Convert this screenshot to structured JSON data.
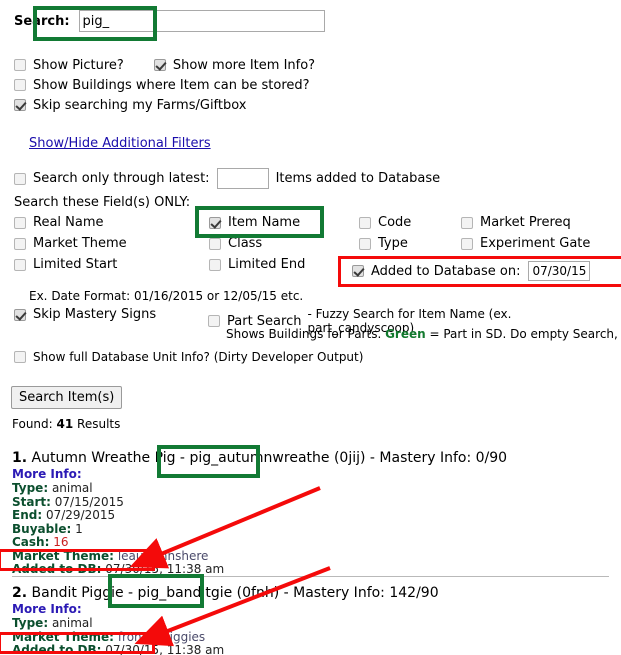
{
  "search": {
    "label": "Search:",
    "value": "pig_",
    "placeholder": ""
  },
  "options": [
    {
      "label": "Show Picture?",
      "checked": false
    },
    {
      "label": "Show more Item Info?",
      "checked": true
    },
    {
      "label": "Show Buildings where Item can be stored?",
      "checked": false
    },
    {
      "label": "Skip searching my Farms/Giftbox",
      "checked": true
    }
  ],
  "filters_link": "Show/Hide Additional Filters",
  "latest": {
    "checkbox_label": "Search only through latest:",
    "checked": false,
    "value": "",
    "suffix": "Items added to Database"
  },
  "fields_heading": "Search these Field(s) ONLY:",
  "fields": [
    {
      "label": "Real Name",
      "checked": false
    },
    {
      "label": "Item Name",
      "checked": true
    },
    {
      "label": "Code",
      "checked": false
    },
    {
      "label": "Market Prereq",
      "checked": false
    },
    {
      "label": "Market Theme",
      "checked": false
    },
    {
      "label": "Class",
      "checked": false
    },
    {
      "label": "Type",
      "checked": false
    },
    {
      "label": "Experiment Gate",
      "checked": false
    },
    {
      "label": "Limited Start",
      "checked": false
    },
    {
      "label": "Limited End",
      "checked": false
    }
  ],
  "added_to_db": {
    "label": "Added to Database on:",
    "checked": true,
    "value": "07/30/15"
  },
  "date_format_hint": "Ex. Date Format: 01/16/2015 or 12/05/15 etc.",
  "mastery": {
    "label": "Skip Mastery Signs",
    "checked": true
  },
  "part_search": {
    "label": "Part Search",
    "checked": false,
    "note": "- Fuzzy Search for Item Name (ex. part_candyscoop)",
    "note2_prefix": "Shows Buildings for Parts. ",
    "note2_green": "Green",
    "note2_suffix": " = Part in SD. Do empty Search, skip fa"
  },
  "full_db_info": {
    "label": "Show full Database Unit Info? (Dirty Developer Output)",
    "checked": false
  },
  "search_button": "Search Item(s)",
  "found": {
    "prefix": "Found:",
    "count": "41",
    "suffix": "Results"
  },
  "results": [
    {
      "num": "1.",
      "name": "Autumn Wreathe Pig",
      "sep1": " - ",
      "code": "pig_autumnwreathe",
      "id": " (0jij) - ",
      "mastery_label": "Mastery Info: ",
      "mastery": "0/90",
      "more_info": "More Info:",
      "fields": [
        {
          "k": "Type:",
          "v": "animal",
          "style": "plain"
        },
        {
          "k": "Start:",
          "v": "07/15/2015",
          "style": "plain"
        },
        {
          "k": "End:",
          "v": "07/29/2015",
          "style": "plain"
        },
        {
          "k": "Buyable:",
          "v": "1",
          "style": "plain"
        },
        {
          "k": "Cash:",
          "v": "16",
          "style": "cash"
        },
        {
          "k": "Market Theme:",
          "v": "leautumnshere",
          "style": ""
        },
        {
          "k": "Added to DB:",
          "v": "07/30/15, 11:38 am",
          "style": "plain"
        }
      ]
    },
    {
      "num": "2.",
      "name": "Bandit Piggie",
      "sep1": " - ",
      "code": "pig_banditgie",
      "id": " (0fnh) - ",
      "mastery_label": "Mastery Info: ",
      "mastery": "142/90",
      "more_info": "More Info:",
      "fields": [
        {
          "k": "Type:",
          "v": "animal",
          "style": "plain"
        },
        {
          "k": "Market Theme:",
          "v": "frontierpiggies",
          "style": ""
        },
        {
          "k": "Added to DB:",
          "v": "07/30/15, 11:38 am",
          "style": "plain"
        }
      ]
    }
  ],
  "annotations": {
    "green": "#127a34",
    "red": "#f40a0a",
    "green_boxes": [
      "search-field-highlight",
      "item-name-checkbox-highlight",
      "result-1-code-highlight",
      "result-2-code-highlight"
    ],
    "red_boxes": [
      "added-to-database-row-highlight",
      "result-1-added-to-db-highlight",
      "result-2-added-to-db-highlight"
    ],
    "red_arrows": [
      "arrow-to-result-1-added-to-db",
      "arrow-to-result-2-added-to-db"
    ]
  }
}
